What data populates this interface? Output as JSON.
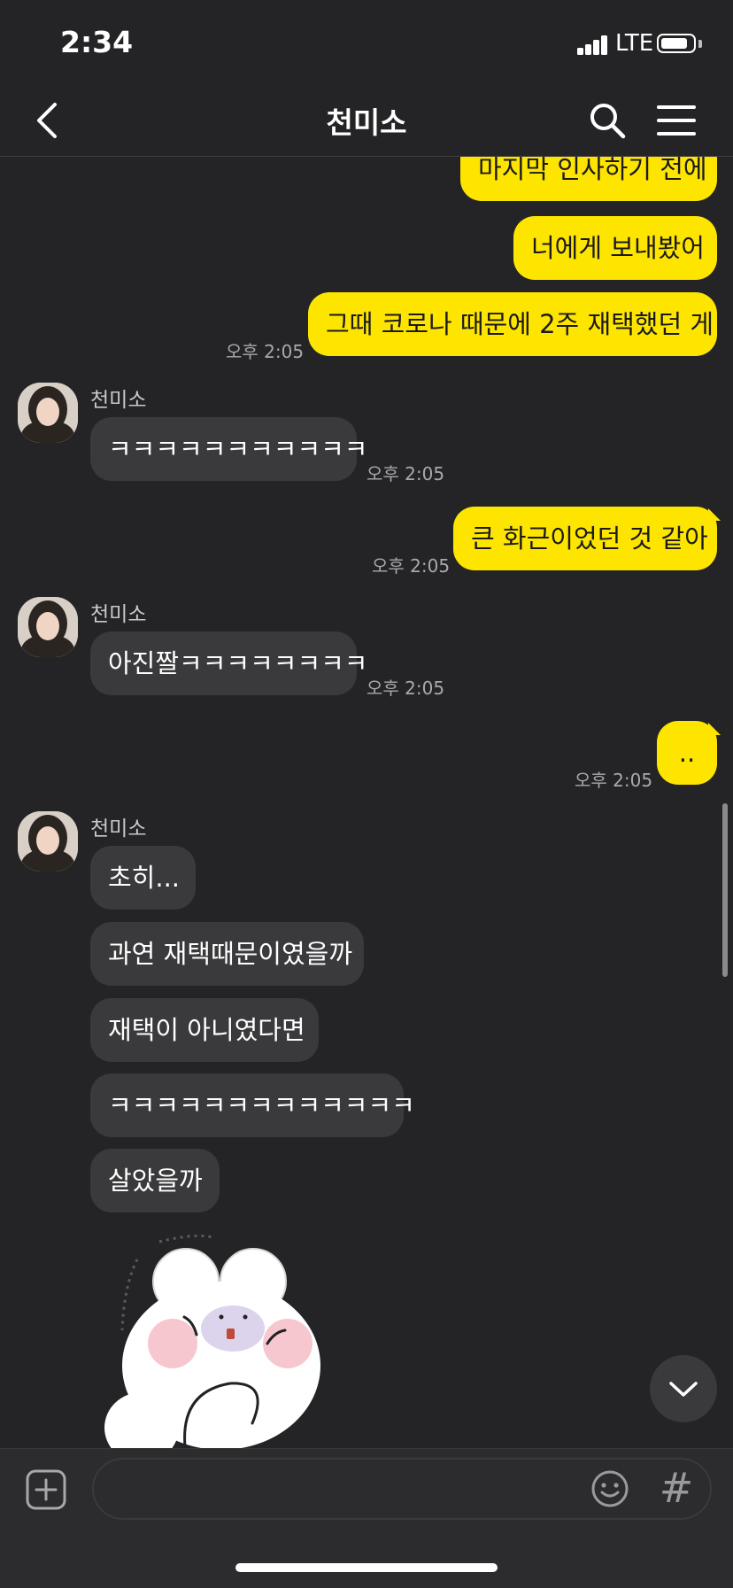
{
  "status": {
    "time": "2:34",
    "network": "LTE"
  },
  "header": {
    "title": "천미소"
  },
  "chat": {
    "sender_name": "천미소",
    "messages": [
      {
        "from": "me",
        "text": "마지막 인사하기 전에"
      },
      {
        "from": "me",
        "text": "너에게 보내봤어"
      },
      {
        "from": "me",
        "text": "그때 코로나 때문에 2주 재택했던 게",
        "time": "오후 2:05"
      },
      {
        "from": "other",
        "text": "ㅋㅋㅋㅋㅋㅋㅋㅋㅋㅋㅋ",
        "time": "오후 2:05"
      },
      {
        "from": "me",
        "text": "큰 화근이었던 것 같아",
        "time": "오후 2:05"
      },
      {
        "from": "other",
        "text": "아진짤ㅋㅋㅋㅋㅋㅋㅋㅋ",
        "time": "오후 2:05"
      },
      {
        "from": "me",
        "text": "..",
        "time": "오후 2:05"
      },
      {
        "from": "other",
        "text": "초히..."
      },
      {
        "from": "other",
        "text": "과연 재택때문이였을까"
      },
      {
        "from": "other",
        "text": "재택이 아니였다면"
      },
      {
        "from": "other",
        "text": "ㅋㅋㅋㅋㅋㅋㅋㅋㅋㅋㅋㅋㅋ"
      },
      {
        "from": "other",
        "text": "살았을까"
      }
    ]
  },
  "colors": {
    "background": "#242426",
    "my_bubble": "#fee500",
    "other_bubble": "#3a3a3c"
  },
  "icons": {
    "back": "back-arrow-icon",
    "search": "search-icon",
    "menu": "hamburger-menu-icon",
    "add": "plus-square-icon",
    "emoji": "emoji-icon",
    "hashtag": "hashtag-icon",
    "scroll_down": "chevron-down-icon"
  },
  "input": {
    "hashtag_glyph": "#"
  }
}
